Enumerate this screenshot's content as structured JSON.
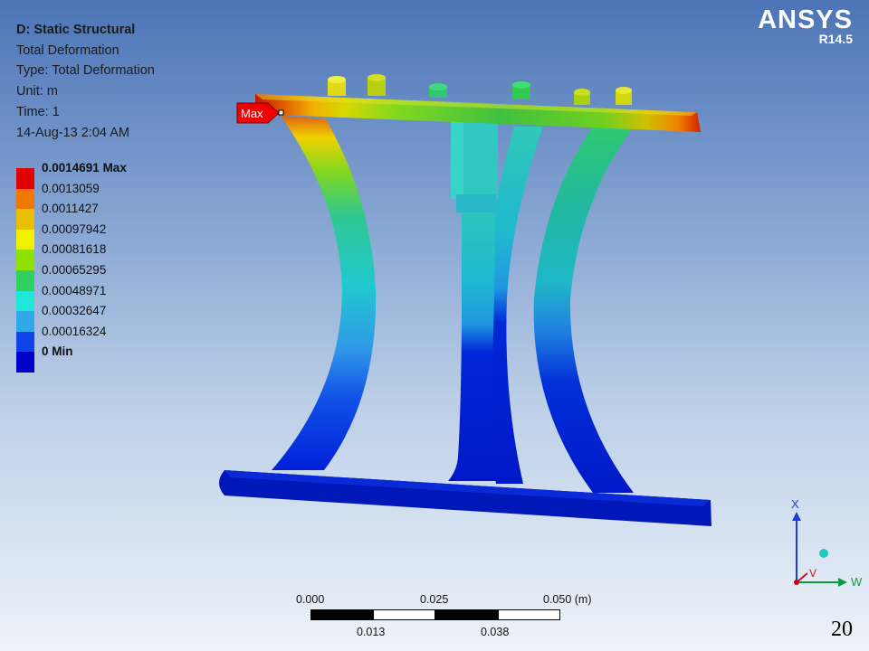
{
  "brand": {
    "name": "ANSYS",
    "version": "R14.5"
  },
  "info": {
    "title": "D: Static Structural",
    "result": "Total Deformation",
    "type": "Type: Total Deformation",
    "unit": "Unit: m",
    "time": "Time: 1",
    "date": "14-Aug-13 2:04 AM"
  },
  "legend": {
    "items": [
      {
        "label": "0.0014691 Max",
        "color": "#e00000"
      },
      {
        "label": "0.0013059",
        "color": "#f07800"
      },
      {
        "label": "0.0011427",
        "color": "#e8c000"
      },
      {
        "label": "0.00097942",
        "color": "#f0f000"
      },
      {
        "label": "0.00081618",
        "color": "#90e000"
      },
      {
        "label": "0.00065295",
        "color": "#30d060"
      },
      {
        "label": "0.00048971",
        "color": "#20e8d8"
      },
      {
        "label": "0.00032647",
        "color": "#30a8e8"
      },
      {
        "label": "0.00016324",
        "color": "#1040e8"
      },
      {
        "label": "0 Min",
        "color": "#0000c8"
      }
    ]
  },
  "probe": {
    "max_label": "Max"
  },
  "scale": {
    "top_ticks": [
      "0.000",
      "0.025",
      "0.050 (m)"
    ],
    "bottom_ticks": [
      "0.013",
      "0.038"
    ]
  },
  "triad": {
    "x_label": "X",
    "v_label": "V",
    "w_label": "W"
  },
  "page_number": "20"
}
